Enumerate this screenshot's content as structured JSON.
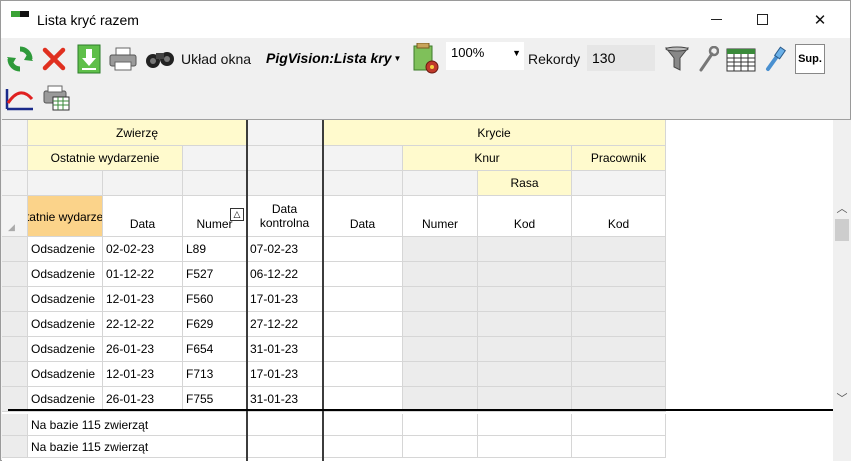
{
  "window": {
    "title": "Lista kryć razem"
  },
  "toolbar": {
    "layout_label": "Układ okna",
    "layout_value": "PigVision:Lista kry",
    "zoom_value": "100%",
    "records_label": "Rekordy",
    "records_value": "130",
    "sup_label": "Sup.",
    "icons": [
      "refresh-icon",
      "delete-icon",
      "download-icon",
      "print-icon",
      "binoculars-icon",
      "layout-settings-icon",
      "filter-icon",
      "wrench-icon",
      "calendar-grid-icon",
      "pipette-icon",
      "sup-icon",
      "chart-curve-icon",
      "print-grid-icon"
    ]
  },
  "grid": {
    "group_headers": {
      "zwierze": "Zwierzę",
      "krycie": "Krycie"
    },
    "sub_headers": {
      "ostatnie_wydarzenie": "Ostatnie wydarzenie",
      "knur": "Knur",
      "pracownik": "Pracownik",
      "rasa": "Rasa"
    },
    "columns": {
      "ostatnie_wydarzenie": "Ostatnie wydarzenie",
      "data": "Data",
      "numer": "Numer",
      "data_kontrolna": "Data kontrolna",
      "krycie_data": "Data",
      "krycie_numer": "Numer",
      "kod_rasa": "Kod",
      "kod_pracownik": "Kod"
    },
    "rows": [
      [
        "Odsadzenie",
        "02-02-23",
        "L89",
        "07-02-23"
      ],
      [
        "Odsadzenie",
        "01-12-22",
        "F527",
        "06-12-22"
      ],
      [
        "Odsadzenie",
        "12-01-23",
        "F560",
        "17-01-23"
      ],
      [
        "Odsadzenie",
        "22-12-22",
        "F629",
        "27-12-22"
      ],
      [
        "Odsadzenie",
        "26-01-23",
        "F654",
        "31-01-23"
      ],
      [
        "Odsadzenie",
        "12-01-23",
        "F713",
        "17-01-23"
      ],
      [
        "Odsadzenie",
        "26-01-23",
        "F755",
        "31-01-23"
      ]
    ],
    "footer": [
      "Na bazie 115 zwierząt",
      "Na bazie 115 zwierząt"
    ]
  },
  "colors": {
    "header_yellow": "#fffacd",
    "sort_column_orange": "#fbd38a",
    "refresh_green": "#2e9a3a",
    "delete_red": "#e03020"
  }
}
